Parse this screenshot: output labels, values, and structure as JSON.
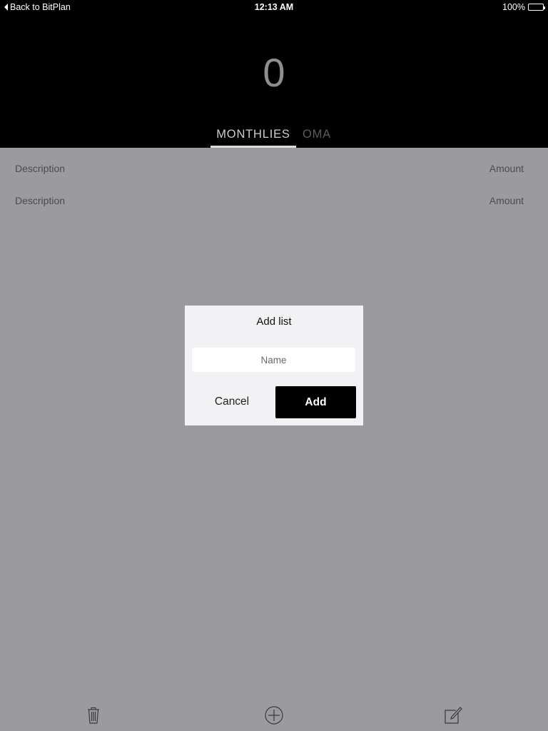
{
  "status_bar": {
    "back_label": "Back to BitPlan",
    "time": "12:13 AM",
    "battery": "100%"
  },
  "header": {
    "balance": "0",
    "tabs": [
      {
        "label": "MONTHLIES",
        "active": true
      },
      {
        "label": "OMA",
        "active": false
      }
    ]
  },
  "list": {
    "rows": [
      {
        "description": "Description",
        "amount": "Amount"
      },
      {
        "description": "Description",
        "amount": "Amount"
      }
    ]
  },
  "dialog": {
    "title": "Add list",
    "name_placeholder": "Name",
    "name_value": "",
    "cancel_label": "Cancel",
    "add_label": "Add"
  },
  "toolbar": {
    "icons": [
      "trash-icon",
      "plus-circle-icon",
      "edit-icon"
    ]
  },
  "colors": {
    "header_bg": "#000000",
    "overlay_bg": "#9b9a9e",
    "dialog_bg": "#f2f2f4",
    "primary_button": "#000000"
  }
}
